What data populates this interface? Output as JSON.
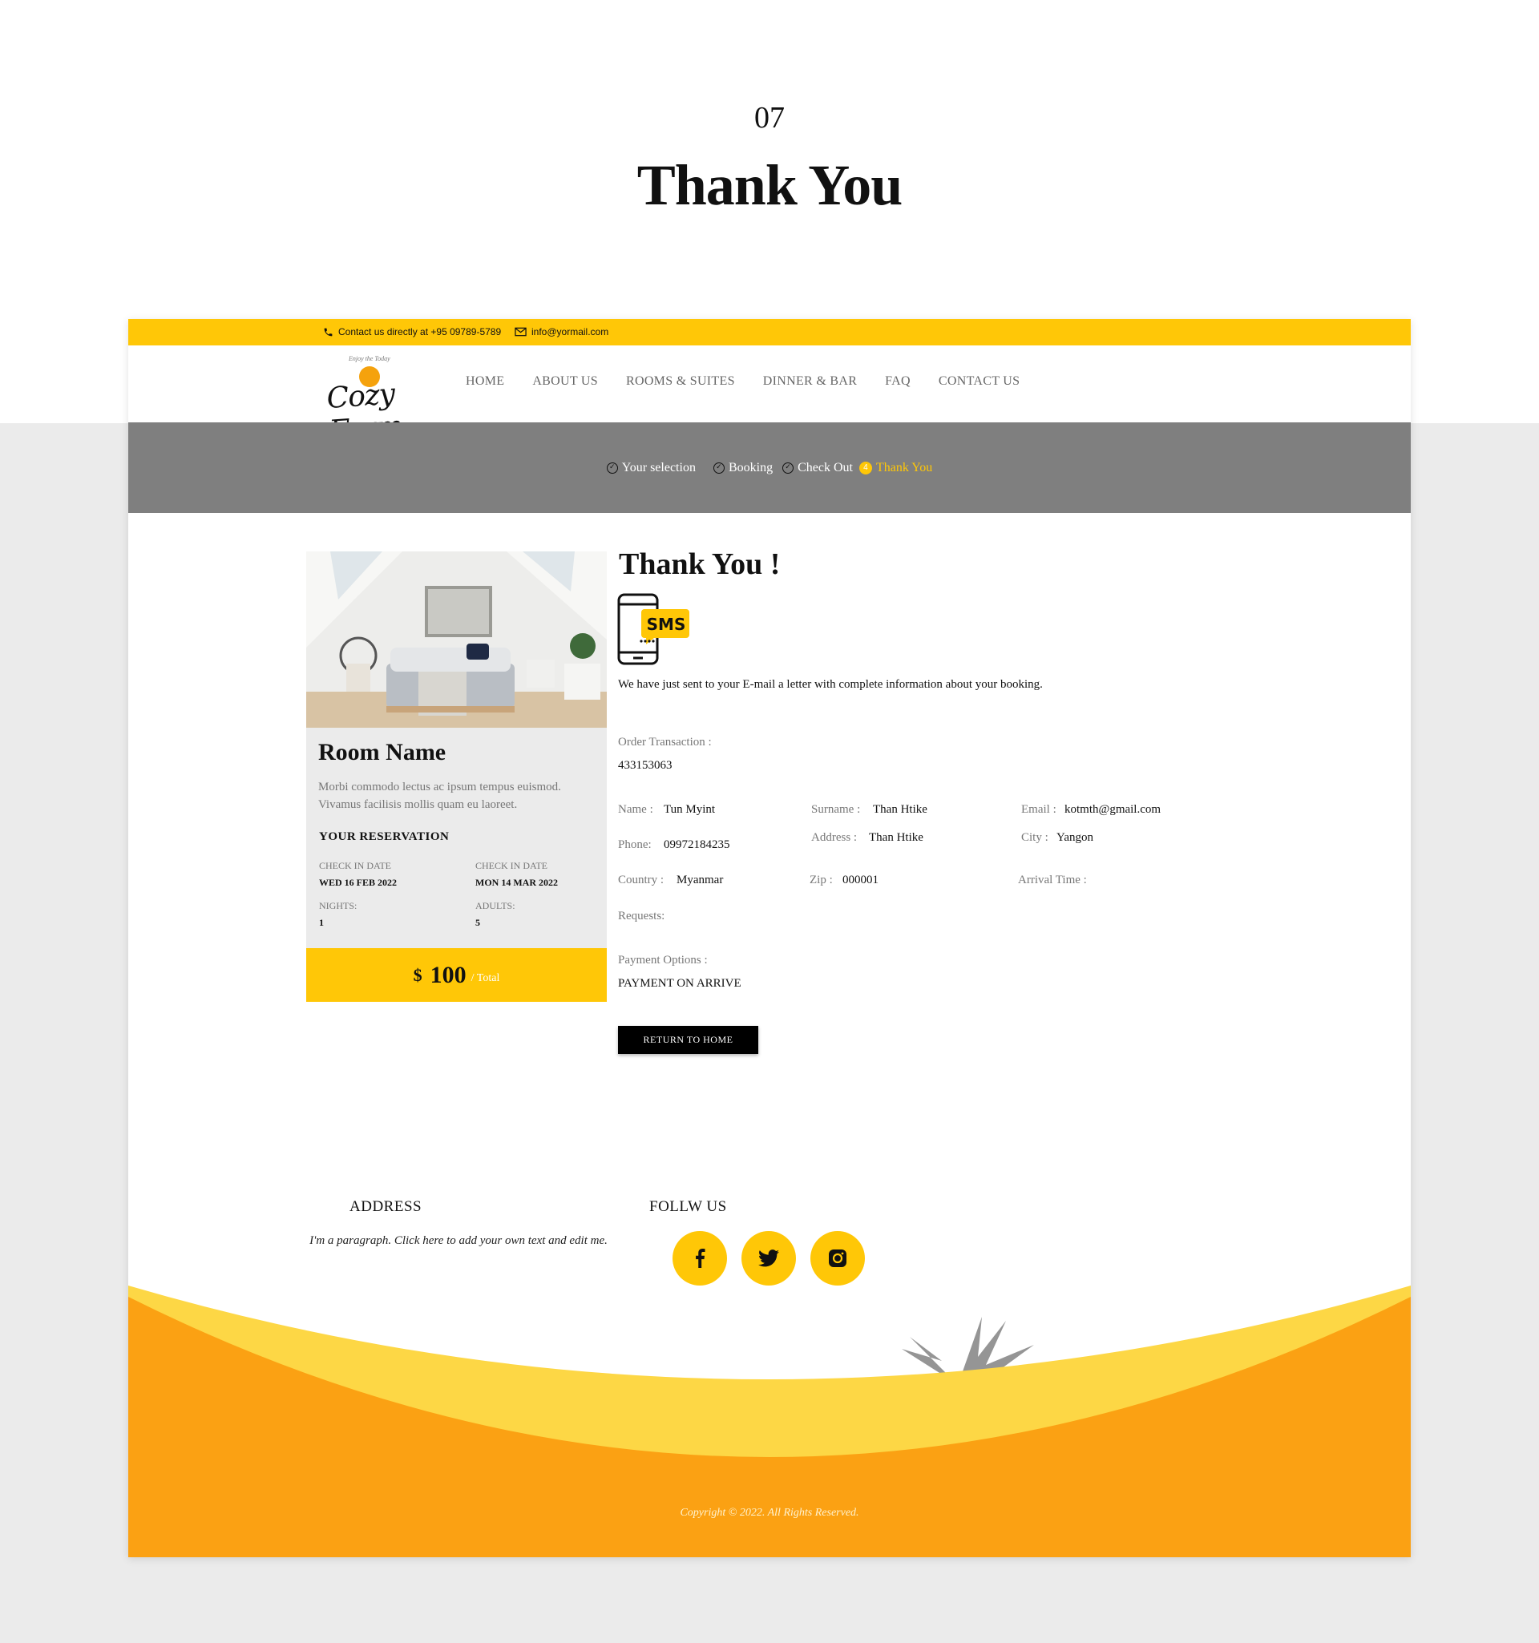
{
  "hero": {
    "number": "07",
    "title": "Thank You"
  },
  "topbar": {
    "phone": "Contact us directly at +95 09789-5789",
    "email": "info@yormail.com"
  },
  "logo": {
    "tagline": "Enjoy the Today",
    "word": "Cozy Farm"
  },
  "menu": [
    "HOME",
    "ABOUT US",
    "ROOMS & SUITES",
    "DINNER & BAR",
    "FAQ",
    "CONTACT US"
  ],
  "steps": [
    {
      "label": "Your selection",
      "done": true
    },
    {
      "label": "Booking",
      "done": true
    },
    {
      "label": "Check Out",
      "done": true
    },
    {
      "label": "Thank You",
      "number": "4"
    }
  ],
  "card": {
    "title": "Room Name",
    "desc": "Morbi commodo lectus ac ipsum tempus euismod. Vivamus facilisis mollis quam eu laoreet.",
    "reservation_heading": "YOUR RESERVATION",
    "fields": [
      {
        "label": "CHECK IN DATE",
        "value": "WED 16 FEB 2022"
      },
      {
        "label": "CHECK IN DATE",
        "value": "MON 14 MAR 2022"
      },
      {
        "label": "NIGHTS:",
        "value": "1"
      },
      {
        "label": "ADULTS:",
        "value": "5"
      }
    ],
    "price": {
      "currency": "$",
      "amount": "100",
      "per": "/ Total"
    }
  },
  "confirm": {
    "title": "Thank You !",
    "sms_label": "SMS",
    "message": "We have just sent to your E-mail a letter  with complete information about your booking.",
    "order_label": "Order Transaction :",
    "order_value": "433153063",
    "name_label": "Name :",
    "name_value": "Tun Myint",
    "surname_label": "Surname :",
    "surname_value": "Than Htike",
    "email_label": "Email :",
    "email_value": "kotmth@gmail.com",
    "phone_label": "Phone:",
    "phone_value": "09972184235",
    "address_label": "Address :",
    "address_value": "Than Htike",
    "city_label": "City :",
    "city_value": "Yangon",
    "country_label": "Country :",
    "country_value": "Myanmar",
    "zip_label": "Zip :",
    "zip_value": "000001",
    "arrival_label": "Arrival Time :",
    "requests_label": "Requests:",
    "payment_label": "Payment Options :",
    "payment_value": "PAYMENT ON ARRIVE",
    "button": "RETURN TO HOME"
  },
  "footer": {
    "address_heading": "ADDRESS",
    "address_text": "I'm a paragraph. Click here to add your own text and edit me.",
    "follow_heading": "FOLLW US",
    "copyright": "Copyright © 2022. All Rights Reserved."
  },
  "colors": {
    "accent": "#ffc707",
    "orange": "#f5a20d",
    "steps_bg": "#7f7f7f"
  }
}
